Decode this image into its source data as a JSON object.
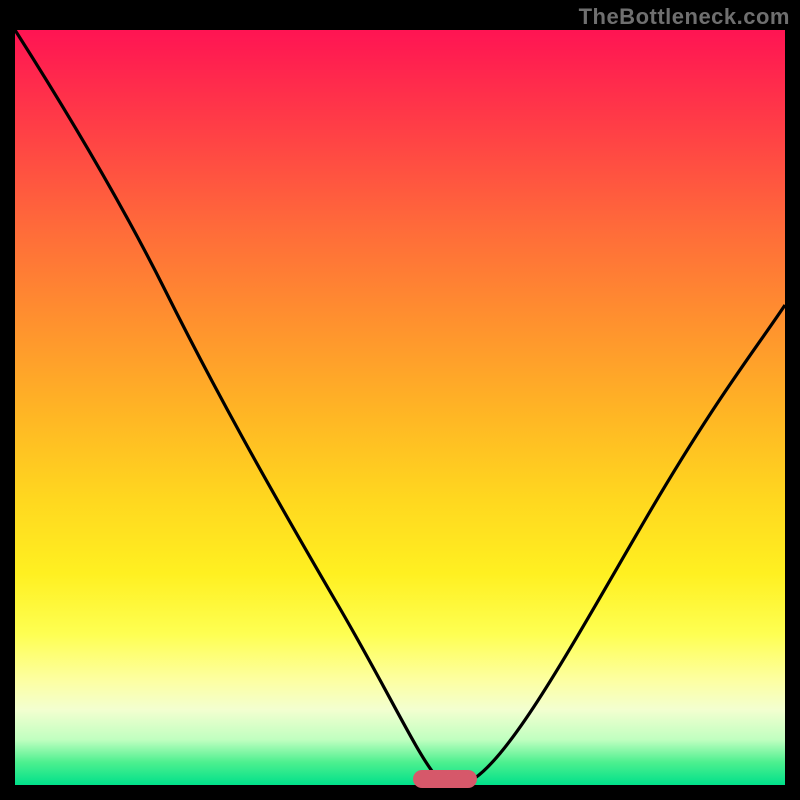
{
  "watermark": "TheBottleneck.com",
  "chart_data": {
    "type": "line",
    "title": "",
    "xlabel": "",
    "ylabel": "",
    "x_range": [
      0,
      100
    ],
    "y_range": [
      0,
      100
    ],
    "grid": false,
    "legend": false,
    "background": "red-orange-yellow-green vertical gradient",
    "series": [
      {
        "name": "bottleneck-curve",
        "x": [
          0,
          6,
          12,
          18,
          24,
          30,
          36,
          42,
          48,
          54,
          56,
          58,
          60,
          66,
          74,
          82,
          90,
          100
        ],
        "y": [
          100,
          90,
          80,
          71,
          63,
          54,
          44,
          33,
          20,
          4,
          1,
          1,
          2,
          12,
          25,
          38,
          50,
          64
        ]
      }
    ],
    "optimum_marker": {
      "x_start": 52,
      "x_end": 60,
      "y": 0
    },
    "colors": {
      "curve": "#000000",
      "marker": "#d6586a",
      "gradient_top": "#ff1453",
      "gradient_bottom": "#00e08a"
    }
  }
}
